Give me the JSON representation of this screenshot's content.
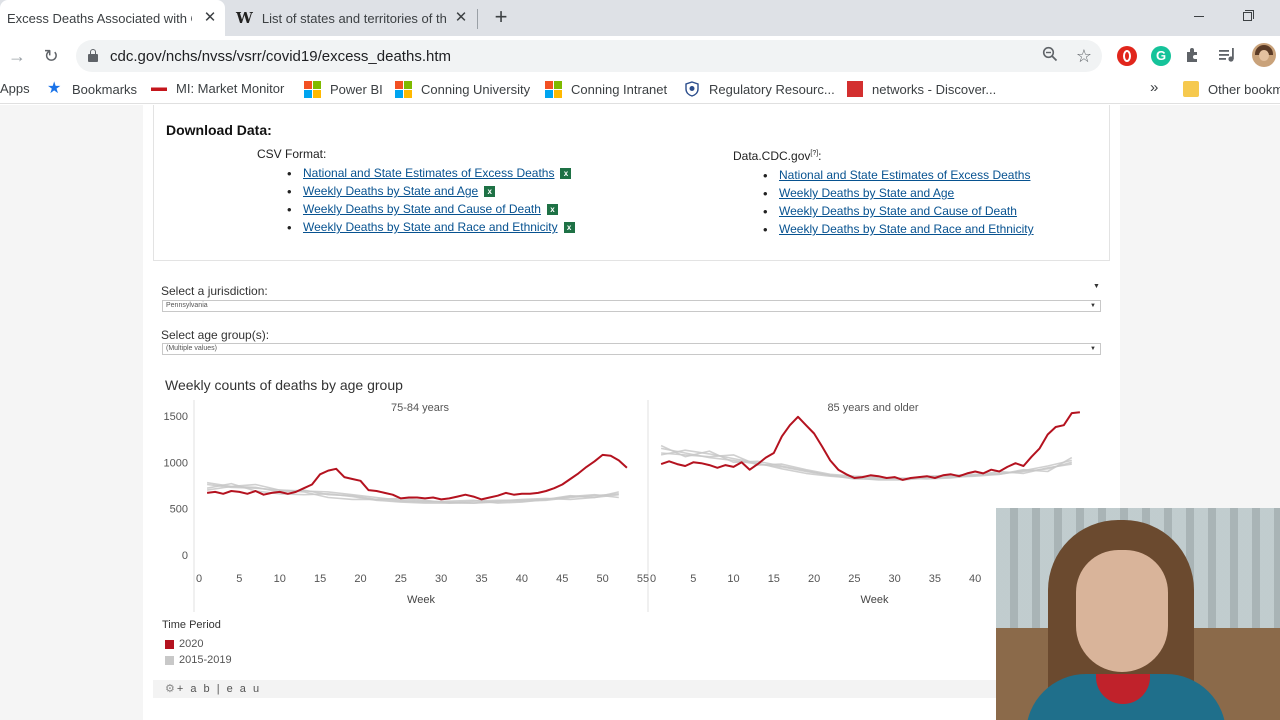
{
  "browser": {
    "tabs": [
      {
        "title": "Excess Deaths Associated with C",
        "favicon": "cdc",
        "active": true
      },
      {
        "title": "List of states and territories of th",
        "favicon": "wikipedia",
        "active": false
      }
    ],
    "favicon_w": "W",
    "close_glyph": "✕",
    "new_tab_glyph": "+",
    "url": "cdc.gov/nchs/nvss/vsrr/covid19/excess_deaths.htm",
    "bookmarks": [
      {
        "label": "Apps"
      },
      {
        "label": "Bookmarks"
      },
      {
        "label": "MI: Market Monitor"
      },
      {
        "label": "Power BI"
      },
      {
        "label": "Conning University"
      },
      {
        "label": "Conning Intranet"
      },
      {
        "label": "Regulatory Resourc..."
      },
      {
        "label": "networks - Discover..."
      },
      {
        "label": "Other bookm"
      }
    ],
    "more_glyph": "»"
  },
  "download": {
    "title": "Download Data:",
    "csv_title": "CSV Format:",
    "data_title": "Data.CDC.gov",
    "data_title_sup": "[?]",
    "data_title_colon": ":",
    "links": [
      "National and State Estimates of Excess Deaths",
      "Weekly Deaths by State and Age",
      "Weekly Deaths by State and Cause of Death",
      "Weekly Deaths by State and Race and Ethnicity"
    ]
  },
  "filters": {
    "jurisdiction_label": "Select a jurisdiction:",
    "jurisdiction_value": "Pennsylvania",
    "age_label": "Select age group(s):",
    "age_value": "(Multiple values)"
  },
  "chart_title": "Weekly counts of deaths by age group",
  "chart_data": {
    "type": "line",
    "title": "Weekly counts of deaths by age group",
    "colors": {
      "2020": "#b4121f",
      "2015-2019": "#c8c8c8"
    },
    "legend_title": "Time Period",
    "legend": [
      "2020",
      "2015-2019"
    ],
    "panels": [
      {
        "name": "75-84 years",
        "xlabel": "Week",
        "x_ticks": [
          0,
          5,
          10,
          15,
          20,
          25,
          30,
          35,
          40,
          45,
          50,
          55
        ],
        "y_ticks": [
          0,
          500,
          1000,
          1500
        ],
        "ylim": [
          0,
          1650
        ],
        "xlim": [
          0,
          55
        ],
        "series": [
          {
            "name": "2020",
            "x": [
              1,
              2,
              3,
              4,
              5,
              6,
              7,
              8,
              9,
              10,
              11,
              12,
              13,
              14,
              15,
              16,
              17,
              18,
              19,
              20,
              21,
              22,
              23,
              24,
              25,
              26,
              27,
              28,
              29,
              30,
              31,
              32,
              33,
              34,
              35,
              36,
              37,
              38,
              39,
              40,
              41,
              42,
              43,
              44,
              45,
              46,
              47,
              48,
              49,
              50,
              51,
              52,
              53
            ],
            "y": [
              670,
              680,
              660,
              690,
              680,
              660,
              690,
              650,
              670,
              680,
              660,
              680,
              720,
              760,
              870,
              910,
              930,
              840,
              820,
              800,
              700,
              690,
              670,
              650,
              610,
              620,
              620,
              610,
              620,
              600,
              610,
              630,
              650,
              630,
              600,
              620,
              640,
              670,
              650,
              660,
              660,
              670,
              690,
              720,
              760,
              820,
              880,
              950,
              1010,
              1080,
              1070,
              1020,
              940
            ]
          },
          {
            "name": "2015-2019",
            "x": [
              1,
              4,
              7,
              10,
              13,
              16,
              19,
              22,
              25,
              28,
              31,
              34,
              37,
              40,
              43,
              46,
              49,
              52
            ],
            "y": [
              760,
              730,
              720,
              700,
              690,
              680,
              650,
              620,
              590,
              580,
              570,
              560,
              570,
              580,
              590,
              620,
              640,
              660
            ]
          },
          {
            "name": "2015-2019",
            "x": [
              1,
              4,
              7,
              10,
              13,
              16,
              19,
              22,
              25,
              28,
              31,
              34,
              37,
              40,
              43,
              46,
              49,
              52
            ],
            "y": [
              720,
              770,
              690,
              660,
              650,
              660,
              630,
              590,
              570,
              560,
              560,
              560,
              580,
              600,
              610,
              600,
              620,
              650
            ]
          },
          {
            "name": "2015-2019",
            "x": [
              1,
              4,
              7,
              10,
              13,
              16,
              19,
              22,
              25,
              28,
              31,
              34,
              37,
              40,
              43,
              46,
              49,
              52
            ],
            "y": [
              700,
              740,
              760,
              700,
              680,
              620,
              600,
              600,
              580,
              570,
              580,
              590,
              560,
              570,
              600,
              630,
              650,
              620
            ]
          },
          {
            "name": "2015-2019",
            "x": [
              1,
              4,
              7,
              10,
              13,
              16,
              19,
              22,
              25,
              28,
              31,
              34,
              37,
              40,
              43,
              46,
              49,
              52
            ],
            "y": [
              780,
              740,
              730,
              680,
              700,
              650,
              640,
              600,
              610,
              590,
              560,
              580,
              590,
              590,
              600,
              640,
              620,
              680
            ]
          }
        ]
      },
      {
        "name": "85 years and older",
        "xlabel": "Week",
        "x_ticks": [
          0,
          5,
          10,
          15,
          20,
          25,
          30,
          35,
          40
        ],
        "ylim": [
          0,
          1650
        ],
        "xlim": [
          0,
          55
        ],
        "series": [
          {
            "name": "2020",
            "x": [
              1,
              2,
              3,
              4,
              5,
              6,
              7,
              8,
              9,
              10,
              11,
              12,
              13,
              14,
              15,
              16,
              17,
              18,
              19,
              20,
              21,
              22,
              23,
              24,
              25,
              26,
              27,
              28,
              29,
              30,
              31,
              32,
              33,
              34,
              35,
              36,
              37,
              38,
              39,
              40,
              41,
              42,
              43,
              44,
              45,
              46,
              47,
              48,
              49,
              50,
              51,
              52,
              53
            ],
            "y": [
              980,
              1010,
              980,
              960,
              1000,
              990,
              970,
              940,
              970,
              950,
              1000,
              920,
              980,
              1050,
              1100,
              1280,
              1400,
              1490,
              1400,
              1310,
              1170,
              1020,
              920,
              870,
              830,
              840,
              860,
              850,
              830,
              840,
              810,
              830,
              840,
              850,
              830,
              860,
              870,
              850,
              880,
              900,
              880,
              920,
              900,
              950,
              990,
              960,
              1060,
              1150,
              1300,
              1380,
              1400,
              1530,
              1540
            ]
          },
          {
            "name": "2015-2019",
            "x": [
              1,
              4,
              7,
              10,
              13,
              16,
              19,
              22,
              25,
              28,
              31,
              34,
              37,
              40,
              43,
              46,
              49,
              52
            ],
            "y": [
              1150,
              1100,
              1050,
              1020,
              980,
              950,
              900,
              860,
              840,
              830,
              820,
              840,
              850,
              860,
              880,
              900,
              930,
              1000
            ]
          },
          {
            "name": "2015-2019",
            "x": [
              1,
              4,
              7,
              10,
              13,
              16,
              19,
              22,
              25,
              28,
              31,
              34,
              37,
              40,
              43,
              46,
              49,
              52
            ],
            "y": [
              1080,
              1130,
              1090,
              1040,
              990,
              930,
              880,
              850,
              830,
              810,
              810,
              830,
              840,
              850,
              870,
              910,
              960,
              1020
            ]
          },
          {
            "name": "2015-2019",
            "x": [
              1,
              4,
              7,
              10,
              13,
              16,
              19,
              22,
              25,
              28,
              31,
              34,
              37,
              40,
              43,
              46,
              49,
              52
            ],
            "y": [
              1180,
              1060,
              1120,
              1000,
              1010,
              960,
              910,
              860,
              820,
              820,
              830,
              820,
              830,
              860,
              900,
              880,
              940,
              980
            ]
          },
          {
            "name": "2015-2019",
            "x": [
              1,
              4,
              7,
              10,
              13,
              16,
              19,
              22,
              25,
              28,
              31,
              34,
              37,
              40,
              43,
              46,
              49,
              52
            ],
            "y": [
              1100,
              1080,
              1060,
              1080,
              970,
              980,
              920,
              870,
              850,
              840,
              820,
              850,
              860,
              870,
              870,
              920,
              900,
              1050
            ]
          }
        ]
      }
    ]
  },
  "tableau_label": "+ a b | e a u"
}
